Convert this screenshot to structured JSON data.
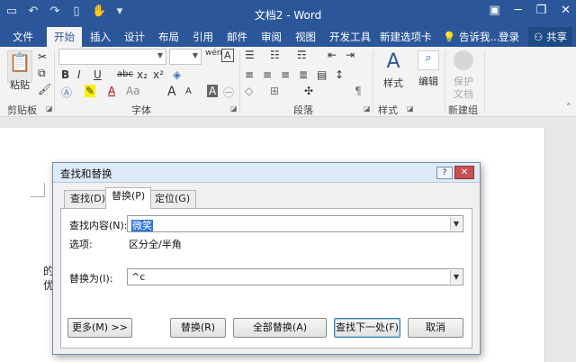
{
  "titlebar": {
    "title": "文档2 - Word",
    "qat_icons": [
      "save-icon",
      "undo-icon",
      "redo-icon",
      "new-doc-icon",
      "touch-mode-icon",
      "customize-qat-icon"
    ],
    "controls": [
      "ribbon-display-icon",
      "minimize-icon",
      "restore-icon",
      "close-icon"
    ]
  },
  "tabs": {
    "items": [
      "文件",
      "开始",
      "插入",
      "设计",
      "布局",
      "引用",
      "邮件",
      "审阅",
      "视图",
      "开发工具",
      "新建选项卡"
    ],
    "active": "开始",
    "tell_me": "告诉我...",
    "signin": "登录",
    "share": "共享"
  },
  "ribbon": {
    "clipboard": {
      "paste": "粘贴",
      "label": "剪贴板"
    },
    "font": {
      "font_name": "",
      "font_size": "",
      "wen_glyph": "wén",
      "bold": "B",
      "italic": "I",
      "underline": "U",
      "strike": "abc",
      "subscript": "x₂",
      "superscript": "x²",
      "font_color_letter": "A",
      "grow": "A",
      "shrink": "A",
      "case": "Aa",
      "label": "字体"
    },
    "paragraph": {
      "label": "段落"
    },
    "styles": {
      "button": "样式",
      "label": "样式"
    },
    "editing": {
      "button": "编辑"
    },
    "protect": {
      "button_line1": "保护",
      "button_line2": "文档",
      "label": "新建组"
    }
  },
  "document": {
    "line1": "的",
    "line2": "优"
  },
  "dialog": {
    "title": "查找和替换",
    "help": "?",
    "tabs": [
      "查找(D)",
      "替换(P)",
      "定位(G)"
    ],
    "active_tab": "替换(P)",
    "find_label": "查找内容(N):",
    "find_value": "微笑",
    "options_label": "选项:",
    "options_value": "区分全/半角",
    "replace_label": "替换为(I):",
    "replace_value": "^c",
    "buttons": {
      "more": "更多(M) >>",
      "replace": "替换(R)",
      "replace_all": "全部替换(A)",
      "find_next": "查找下一处(F)",
      "cancel": "取消"
    }
  },
  "colors": {
    "brand": "#2b579a",
    "ribbon_bg": "#f3f3f3",
    "dialog_title_bg": "#ddeaf8",
    "close_red": "#c75050",
    "selection": "#3074d6"
  }
}
